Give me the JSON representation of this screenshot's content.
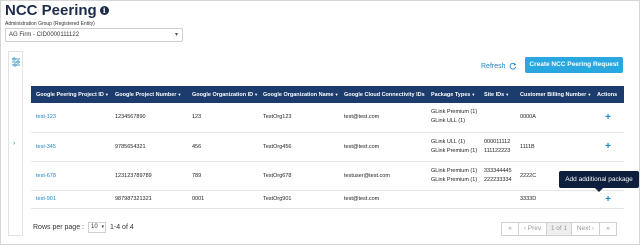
{
  "page": {
    "title": "NCC Peering",
    "info_icon": "info-icon"
  },
  "admin_group": {
    "label": "Administration Group (Registered Entity)",
    "value": "AG Firm - CID0000111122"
  },
  "toolbar": {
    "refresh_label": "Refresh",
    "create_label": "Create NCC Peering Request",
    "create_color": "#29a7e1"
  },
  "table": {
    "header_color": "#1d3c6e",
    "columns": [
      "Google Peering Project ID",
      "Google Project Number",
      "Google Organization ID",
      "Google Organization Name",
      "Google Cloud Connectivity IDs",
      "Package Types",
      "Site IDs",
      "Customer Billing Number",
      "Actions"
    ],
    "rows": [
      {
        "project_id": "test-123",
        "project_number": "1234567890",
        "org_id": "123",
        "org_name": "TestOrg123",
        "connectivity": "test@test.com",
        "package_types": [
          "GLink Premium (1)",
          "GLink ULL (1)"
        ],
        "site_ids": [],
        "billing": "0000A",
        "action": "+"
      },
      {
        "project_id": "test-345",
        "project_number": "9785654321",
        "org_id": "456",
        "org_name": "TestOrg456",
        "connectivity": "test@test.com",
        "package_types": [
          "GLink ULL (1)",
          "GLink Premium (1)"
        ],
        "site_ids": [
          "000011112",
          "111122223"
        ],
        "billing": "1111B",
        "action": "+"
      },
      {
        "project_id": "test-678",
        "project_number": "123123789789",
        "org_id": "789",
        "org_name": "TestOrg678",
        "connectivity": "testuser@test.com",
        "package_types": [
          "GLink Premium (1)",
          "GLink Premium (1)"
        ],
        "site_ids": [
          "333344445",
          "222233334"
        ],
        "billing": "2222C",
        "action": "+"
      },
      {
        "project_id": "test-901",
        "project_number": "987987321321",
        "org_id": "0001",
        "org_name": "TestOrg901",
        "connectivity": "test@test.com",
        "package_types": [],
        "site_ids": [],
        "billing": "3333D",
        "action": "+"
      }
    ]
  },
  "tooltip": "Add additional package",
  "pagination": {
    "rows_per_page_label": "Rows per page :",
    "rows_per_page_value": "10",
    "range": "1-4 of 4",
    "first": "«",
    "prev": "‹ Prev",
    "current": "1 of 1",
    "next": "Next ›",
    "last": "»"
  }
}
